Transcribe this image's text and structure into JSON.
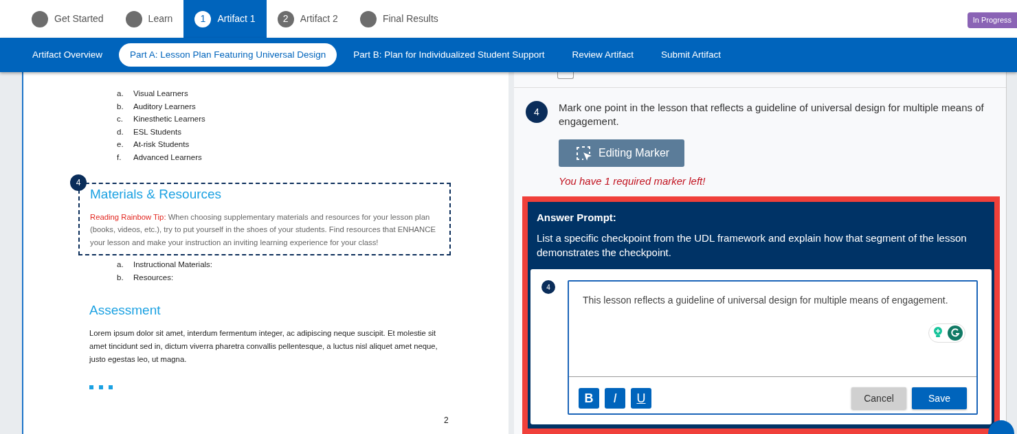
{
  "steps": [
    {
      "label": "Get Started",
      "selected": false
    },
    {
      "label": "Learn",
      "selected": false
    },
    {
      "label": "Artifact 1",
      "number": "1",
      "selected": true
    },
    {
      "label": "Artifact 2",
      "number": "2",
      "selected": false
    },
    {
      "label": "Final Results",
      "selected": false
    }
  ],
  "status_badge": "In Progress",
  "subnav": [
    {
      "label": "Artifact Overview",
      "selected": false
    },
    {
      "label": "Part A: Lesson Plan Featuring Universal Design",
      "selected": true
    },
    {
      "label": "Part B: Plan for Individualized Student Support",
      "selected": false
    },
    {
      "label": "Review Artifact",
      "selected": false
    },
    {
      "label": "Submit Artifact",
      "selected": false
    }
  ],
  "document": {
    "learner_list": [
      {
        "marker": "a.",
        "text": "Visual Learners"
      },
      {
        "marker": "b.",
        "text": "Auditory Learners"
      },
      {
        "marker": "c.",
        "text": "Kinesthetic Learners"
      },
      {
        "marker": "d.",
        "text": "ESL Students"
      },
      {
        "marker": "e.",
        "text": "At-risk Students"
      },
      {
        "marker": "f.",
        "text": "Advanced Learners"
      }
    ],
    "marked_section": {
      "marker": "4",
      "heading": "Materials & Resources",
      "tip_label": "Reading Rainbow Tip:",
      "tip_text": "When choosing supplementary materials and resources for your lesson plan (books, videos, etc.), try to put yourself in the shoes of your students. Find resources that ENHANCE your lesson and make your instruction an inviting learning experience for your class!"
    },
    "materials_list": [
      {
        "marker": "a.",
        "text": "Instructional Materials:"
      },
      {
        "marker": "b.",
        "text": "Resources:"
      }
    ],
    "assessment_heading": "Assessment",
    "assessment_text": "Lorem ipsum dolor sit amet, interdum fermentum integer, ac adipiscing neque suscipit. Et molestie sit amet tincidunt sed in, dictum viverra pharetra convallis pellentesque, a luctus nisl aliquet amet neque, justo egestas leo, ut magna.",
    "page_number": "2"
  },
  "question": {
    "number": "4",
    "text": "Mark one point in the lesson that reflects a guideline of universal design for multiple means of engagement.",
    "marker_button": "Editing Marker",
    "warning": "You have 1 required marker left!"
  },
  "answer_prompt": {
    "title": "Answer Prompt:",
    "text": "List a specific checkpoint from the UDL framework and explain how that segment of the lesson demonstrates the checkpoint.",
    "editor": {
      "marker": "4",
      "value": "This lesson reflects a guideline of universal design for multiple means of engagement.",
      "format_buttons": [
        {
          "kind": "bold",
          "label": "B"
        },
        {
          "kind": "italic",
          "label": "I"
        },
        {
          "kind": "underline",
          "label": "U"
        }
      ],
      "cancel": "Cancel",
      "save": "Save"
    }
  }
}
